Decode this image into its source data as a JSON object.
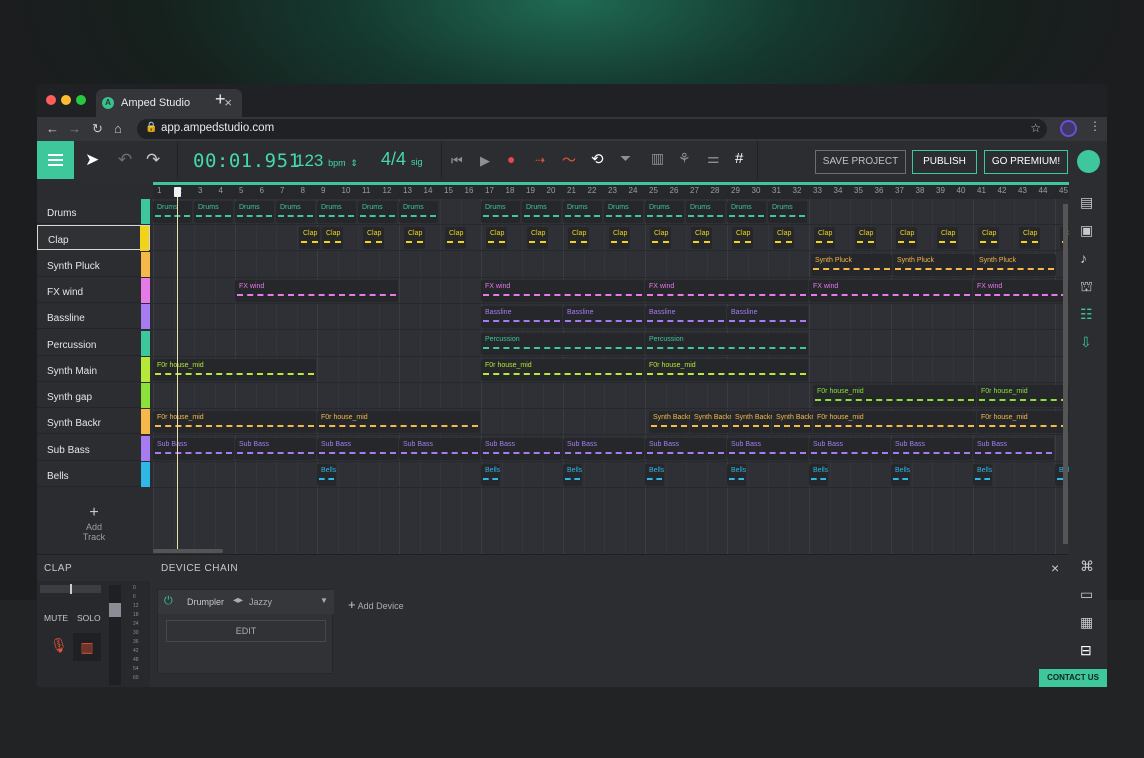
{
  "browser": {
    "tab_title": "Amped Studio",
    "tab_close": "×",
    "new_tab": "+",
    "url": "app.ampedstudio.com",
    "favicon": "A"
  },
  "toolbar": {
    "time": "00:01.951",
    "bpm_value": "123",
    "bpm_unit": "bpm",
    "sig_value": "4/4",
    "sig_unit": "sig",
    "save_label": "SAVE PROJECT",
    "publish_label": "PUBLISH",
    "premium_label": "GO PREMIUM!"
  },
  "ruler_ticks": [
    "1",
    "2",
    "3",
    "4",
    "5",
    "6",
    "7",
    "8",
    "9",
    "10",
    "11",
    "12",
    "13",
    "14",
    "15",
    "16",
    "17",
    "18",
    "19",
    "20",
    "21",
    "22",
    "23",
    "24",
    "25",
    "26",
    "27",
    "28",
    "29",
    "30",
    "31",
    "32",
    "33",
    "34",
    "35",
    "36",
    "37",
    "38",
    "39",
    "40",
    "41",
    "42",
    "43",
    "44",
    "45"
  ],
  "tracks": [
    {
      "name": "Drums",
      "color": "#3ec79a"
    },
    {
      "name": "Clap",
      "color": "#f2d31b"
    },
    {
      "name": "Synth Pluck",
      "color": "#f7b84a"
    },
    {
      "name": "FX wind",
      "color": "#e57ae8"
    },
    {
      "name": "Bassline",
      "color": "#a77cf2"
    },
    {
      "name": "Percussion",
      "color": "#3ec79a"
    },
    {
      "name": "Synth Main",
      "color": "#b6e83a"
    },
    {
      "name": "Synth gap",
      "color": "#8be03a"
    },
    {
      "name": "Synth Backr",
      "color": "#f7b84a"
    },
    {
      "name": "Sub Bass",
      "color": "#a77cf2"
    },
    {
      "name": "Bells",
      "color": "#2fb7e8"
    }
  ],
  "add_track": "Add Track",
  "panel": {
    "track_title": "CLAP",
    "mute": "MUTE",
    "solo": "SOLO",
    "device_chain": "DEVICE CHAIN",
    "close": "×",
    "device_name": "Drumpler",
    "preset": "Jazzy",
    "edit": "EDIT",
    "add_device": "Add Device",
    "meter_ticks": [
      "0",
      "6",
      "12",
      "18",
      "24",
      "30",
      "36",
      "42",
      "48",
      "54",
      "60"
    ]
  },
  "contact": "CONTACT US",
  "clips": [
    {
      "row": 0,
      "label": "Drums",
      "starts": [
        0,
        41,
        82,
        123,
        164,
        205,
        246,
        328,
        369,
        410,
        451,
        492,
        533,
        574,
        615
      ],
      "len": 40
    },
    {
      "row": 1,
      "label": "Clap",
      "starts": [
        146,
        169,
        210,
        251,
        292,
        333,
        374,
        415,
        456,
        497,
        538,
        579,
        620,
        661,
        702,
        743,
        784,
        825,
        866,
        907
      ],
      "len": 22
    },
    {
      "row": 2,
      "label": "Synth Pluck",
      "starts": [
        658,
        740,
        822
      ],
      "len": 82
    },
    {
      "row": 3,
      "label": "FX wind",
      "starts": [
        82,
        328,
        492,
        656,
        820
      ],
      "len": 164
    },
    {
      "row": 4,
      "label": "Bassline",
      "starts": [
        328,
        410,
        492,
        574
      ],
      "len": 82
    },
    {
      "row": 5,
      "label": "Percussion",
      "starts": [
        328,
        492
      ],
      "len": 164
    },
    {
      "row": 6,
      "label": "F0r house_mid",
      "starts": [
        0,
        328,
        492
      ],
      "len": 164
    },
    {
      "row": 7,
      "label": "F0r house_mid",
      "starts": [
        660,
        824
      ],
      "len": 164
    },
    {
      "row": 8,
      "label": "F0r house_mid",
      "starts": [
        0,
        164
      ],
      "len": 164
    },
    {
      "row": 8,
      "label": "Synth Backr",
      "starts": [
        496,
        537,
        578,
        619
      ],
      "len": 41
    },
    {
      "row": 8,
      "label": "F0r house_mid",
      "starts": [
        660,
        824
      ],
      "len": 164
    },
    {
      "row": 9,
      "label": "Sub Bass",
      "starts": [
        0,
        82,
        164,
        246,
        328,
        410,
        492,
        574,
        656,
        738,
        820
      ],
      "len": 82
    },
    {
      "row": 10,
      "label": "Bells",
      "starts": [
        164,
        328,
        410,
        492,
        574,
        656,
        738,
        820,
        902
      ],
      "len": 20
    }
  ]
}
